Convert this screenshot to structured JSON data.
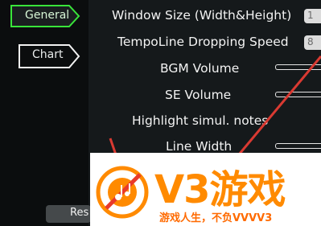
{
  "tabs": [
    {
      "label": "General",
      "active": true,
      "outline_color": "#39e43a"
    },
    {
      "label": "Chart",
      "active": false,
      "outline_color": "#ffffff"
    }
  ],
  "settings": [
    {
      "label": "Window Size (Width&Height)",
      "control": "number-field",
      "value": "1"
    },
    {
      "label": "TempoLine Dropping Speed",
      "control": "number-field",
      "value": "8"
    },
    {
      "label": "BGM Volume",
      "control": "slider"
    },
    {
      "label": "SE Volume",
      "control": "slider"
    },
    {
      "label": "Highlight simul. notes",
      "control": "toggle"
    },
    {
      "label": "Line Width",
      "control": "slider"
    }
  ],
  "reset_button": {
    "label": "Res"
  },
  "watermark": {
    "brand": "V3游戏",
    "slogan": "游戏人生，不负VVVV3",
    "icon": "music-note-icon",
    "colors": {
      "orange": "#ff8a00",
      "red": "#e8392b"
    }
  },
  "annotation_color": "#d93a32"
}
